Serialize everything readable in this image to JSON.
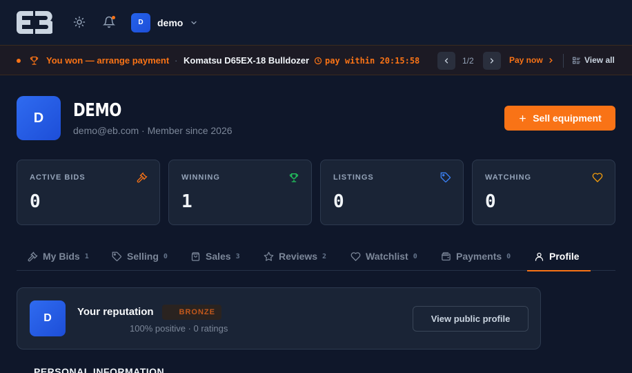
{
  "header": {
    "user_initial": "D",
    "user_name": "demo"
  },
  "banner": {
    "status": "You won — arrange payment",
    "separator": "·",
    "item_name": "Komatsu D65EX-18 Bulldozer",
    "pay_within": "pay within 20:15:58",
    "pager": "1/2",
    "pay_now": "Pay now",
    "view_all": "View all"
  },
  "profile": {
    "initial": "D",
    "name": "DEMO",
    "subtitle": "demo@eb.com · Member since 2026",
    "sell_label": "Sell equipment"
  },
  "stats": [
    {
      "label": "ACTIVE BIDS",
      "value": "0",
      "icon": "gavel-icon",
      "color": "#f97316"
    },
    {
      "label": "WINNING",
      "value": "1",
      "icon": "trophy-icon",
      "color": "#22c55e"
    },
    {
      "label": "LISTINGS",
      "value": "0",
      "icon": "tag-icon",
      "color": "#3b82f6"
    },
    {
      "label": "WATCHING",
      "value": "0",
      "icon": "heart-icon",
      "color": "#f59e0b"
    }
  ],
  "tabs": [
    {
      "label": "My Bids",
      "count": "1",
      "icon": "gavel-icon"
    },
    {
      "label": "Selling",
      "count": "0",
      "icon": "tag-icon"
    },
    {
      "label": "Sales",
      "count": "3",
      "icon": "bag-icon"
    },
    {
      "label": "Reviews",
      "count": "2",
      "icon": "star-icon"
    },
    {
      "label": "Watchlist",
      "count": "0",
      "icon": "heart-icon"
    },
    {
      "label": "Payments",
      "count": "0",
      "icon": "wallet-icon"
    },
    {
      "label": "Profile",
      "count": "",
      "icon": "user-icon"
    }
  ],
  "reputation": {
    "initial": "D",
    "title": "Your reputation",
    "badge": "BRONZE",
    "summary": "100% positive · 0 ratings",
    "view_label": "View public profile"
  },
  "section": {
    "heading": "PERSONAL INFORMATION"
  },
  "colors": {
    "accent": "#f97316",
    "background": "#0f172a",
    "card": "#1a2436"
  }
}
